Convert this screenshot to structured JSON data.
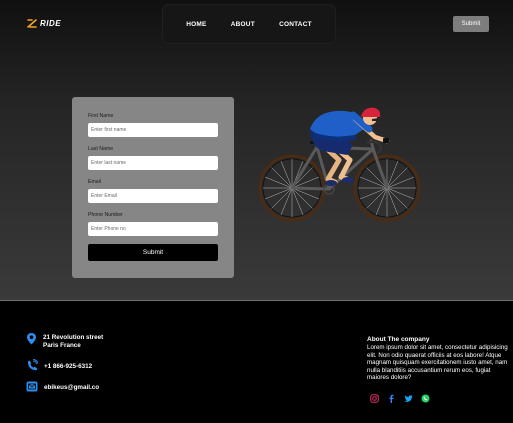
{
  "header": {
    "logo_text": "RIDE",
    "nav": [
      "HOME",
      "ABOUT",
      "CONTACT"
    ],
    "submit_label": "Submit"
  },
  "form": {
    "fields": [
      {
        "label": "First Name",
        "placeholder": "Enter first name"
      },
      {
        "label": "Last Name",
        "placeholder": "Enter last name"
      },
      {
        "label": "Email",
        "placeholder": "Enter Email"
      },
      {
        "label": "Phone Number",
        "placeholder": "Enter Phone no"
      }
    ],
    "submit_label": "Submit"
  },
  "footer": {
    "address_line1": "21 Revolution street",
    "address_line2": "Paris France",
    "phone": "+1 866-925-6312",
    "email": "ebikeus@gmail.co",
    "about_title": "About The company",
    "about_text": "Lorem ipsum dolor sit amet, consectetur adipisicing elit. Non odio quaerat officiis at eos labore! Atque magnam quisquam exercitationem iusto amet, nam nulla blanditiis accusantium rerum eos, fugiat maiores dolore?",
    "socials": [
      "instagram-icon",
      "facebook-icon",
      "twitter-icon",
      "whatsapp-icon"
    ]
  },
  "colors": {
    "accent_logo": "#f5a623",
    "icon_blue": "#2d8cf0",
    "form_bg": "#868686",
    "top_submit_bg": "#7d7d7d"
  }
}
